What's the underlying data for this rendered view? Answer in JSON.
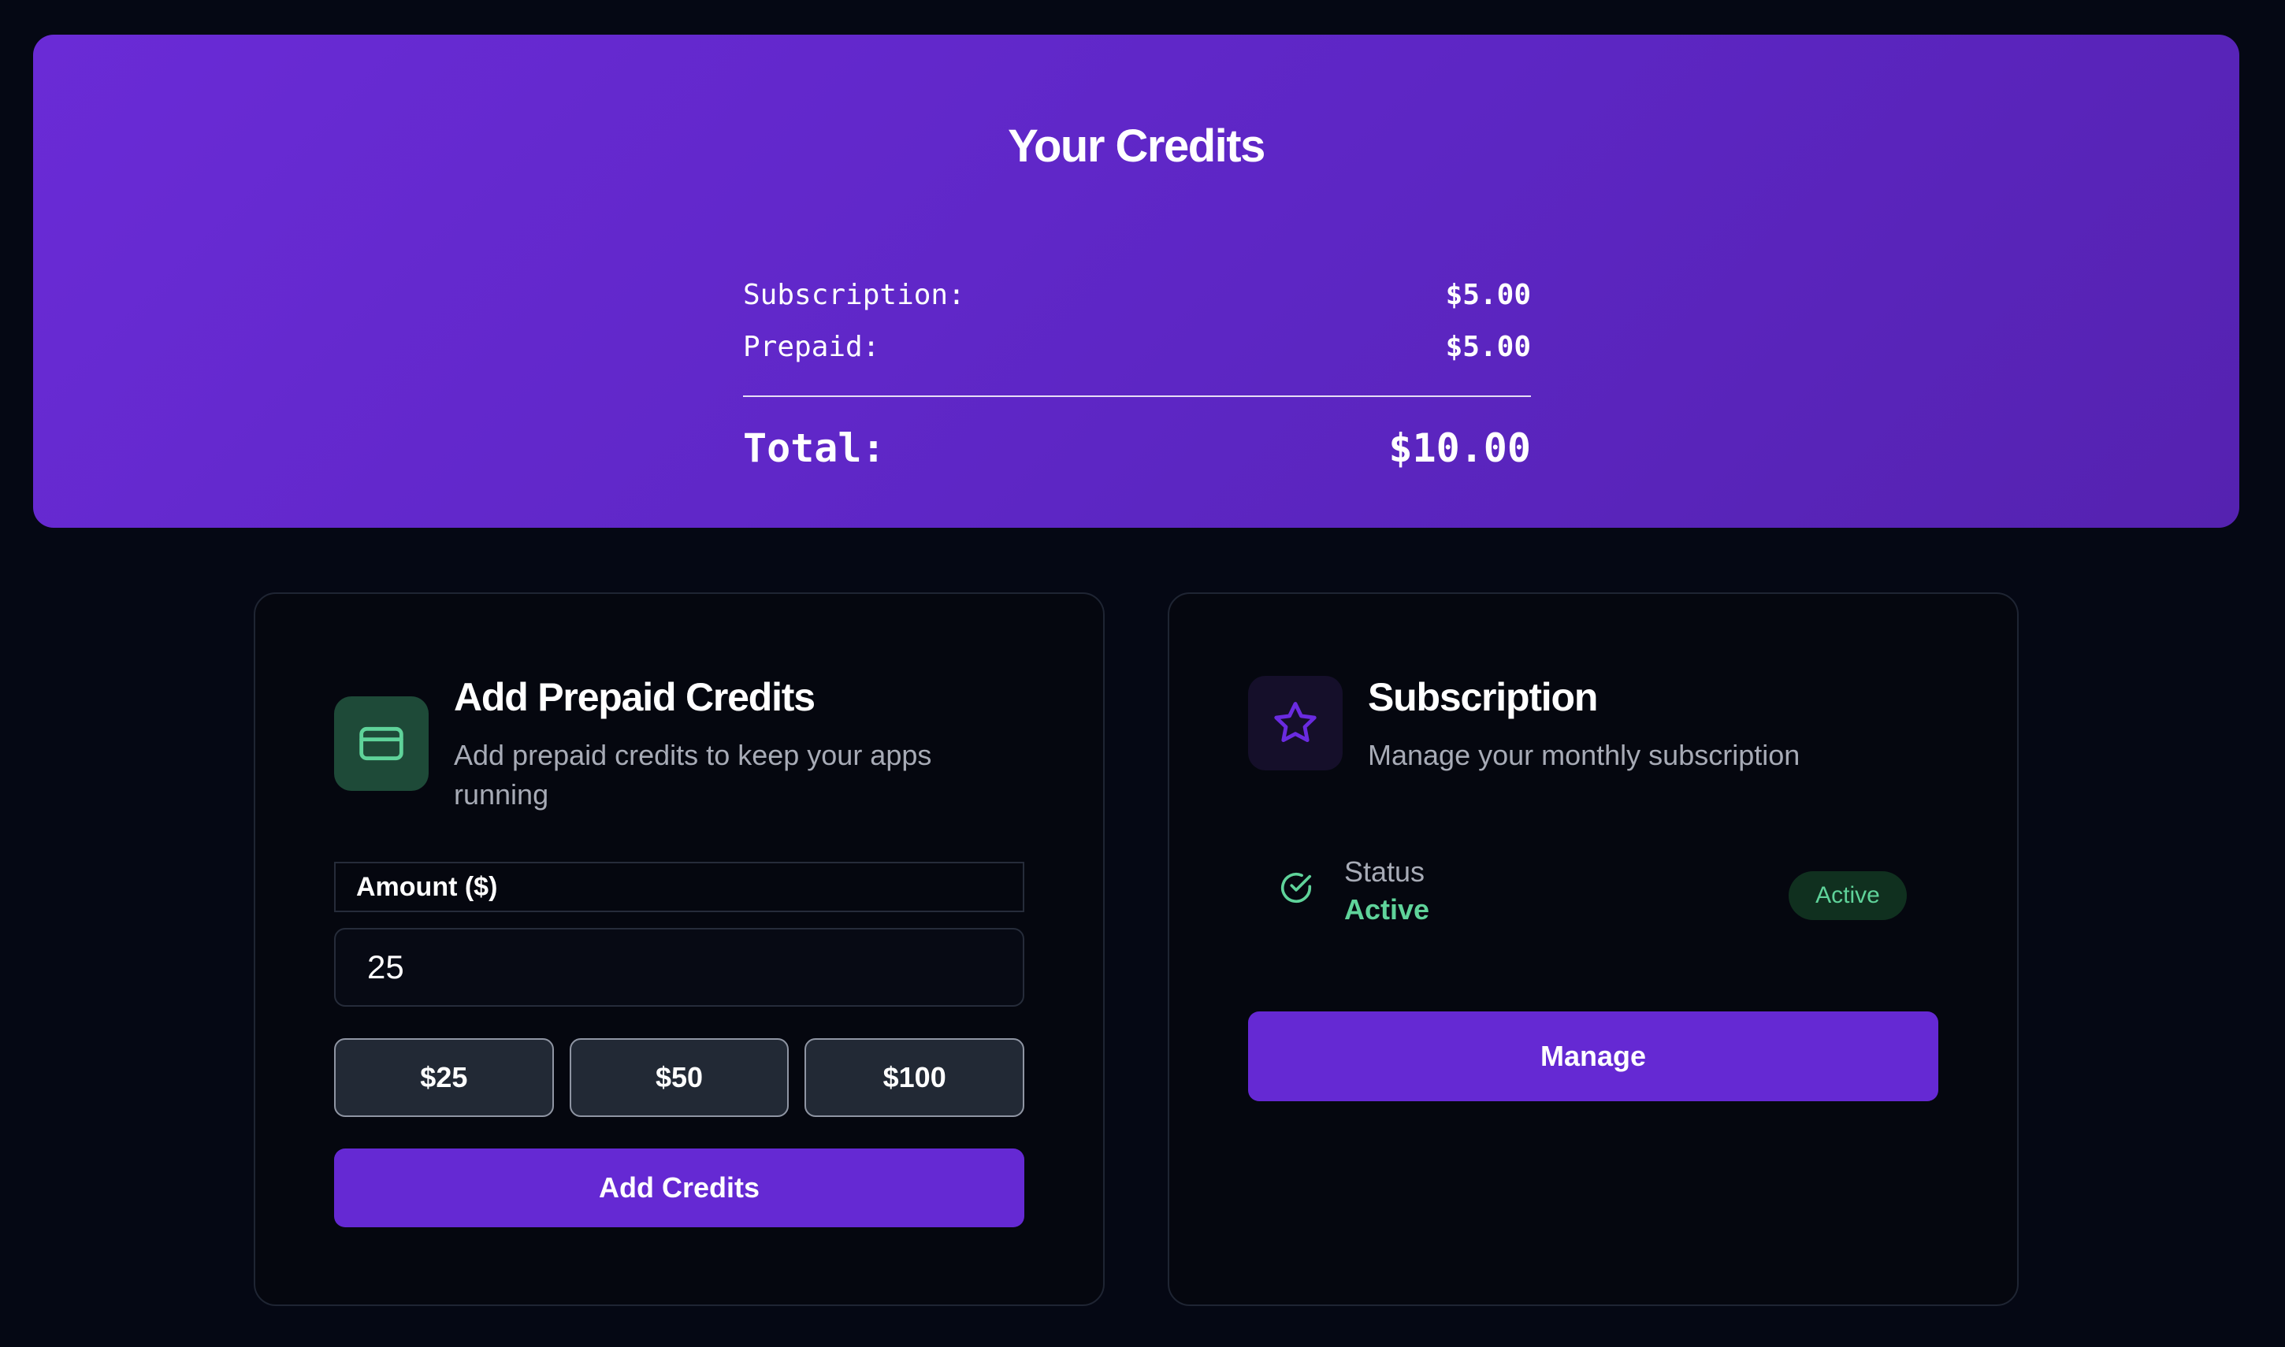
{
  "hero": {
    "title": "Your Credits",
    "subscription_label": "Subscription:",
    "subscription_value": "$5.00",
    "prepaid_label": "Prepaid:",
    "prepaid_value": "$5.00",
    "total_label": "Total:",
    "total_value": "$10.00"
  },
  "prepaid_card": {
    "icon": "credit-card-icon",
    "title": "Add Prepaid Credits",
    "description": "Add prepaid credits to keep your apps running",
    "amount_label": "Amount ($)",
    "amount_value": "25",
    "presets": [
      "$25",
      "$50",
      "$100"
    ],
    "submit_label": "Add Credits"
  },
  "subscription_card": {
    "icon": "star-icon",
    "title": "Subscription",
    "description": "Manage your monthly subscription",
    "status_icon": "check-circle-icon",
    "status_label": "Status",
    "status_value": "Active",
    "badge": "Active",
    "manage_label": "Manage"
  },
  "colors": {
    "background": "#050814",
    "hero_gradient_start": "#6a2bd6",
    "hero_gradient_end": "#5522b0",
    "accent": "#6529d3",
    "success": "#5fd39a",
    "muted_text": "#a7abb6"
  }
}
